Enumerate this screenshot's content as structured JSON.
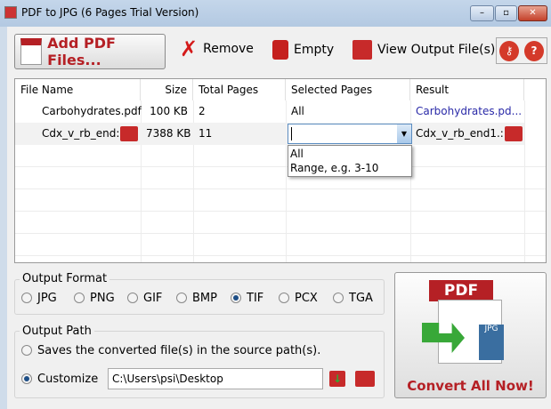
{
  "window": {
    "title": "PDF to JPG (6 Pages Trial Version)",
    "min": "–",
    "max": "▫",
    "close": "✕"
  },
  "toolbar": {
    "add_label": "Add PDF Files...",
    "remove_label": "Remove",
    "empty_label": "Empty",
    "view_label": "View Output File(s)"
  },
  "table": {
    "headers": [
      "File Name",
      "Size",
      "Total Pages",
      "Selected Pages",
      "Result"
    ],
    "rows": [
      {
        "name": "Carbohydrates.pdf",
        "size": "100 KB",
        "pages": "2",
        "selected": "All",
        "result": "Carbohydrates.pd..."
      },
      {
        "name": "Cdx_v_rb_end:",
        "size": "7388 KB",
        "pages": "11",
        "selected": "",
        "result": "Cdx_v_rb_end1.:"
      }
    ],
    "dropdown_options": [
      "All",
      "Range, e.g. 3-10"
    ]
  },
  "output_format": {
    "label": "Output Format",
    "options": [
      "JPG",
      "PNG",
      "GIF",
      "BMP",
      "TIF",
      "PCX",
      "TGA"
    ],
    "selected": "TIF"
  },
  "output_path": {
    "label": "Output Path",
    "source_option": "Saves the converted file(s) in the source path(s).",
    "customize_option": "Customize",
    "path_value": "C:\\Users\\psi\\Desktop",
    "selected": "Customize"
  },
  "convert": {
    "label": "Convert All Now!",
    "pdf_badge": "PDF",
    "jpg_badge": "JPG"
  },
  "colors": {
    "accent": "#b52025",
    "link": "#2a2aa8"
  }
}
